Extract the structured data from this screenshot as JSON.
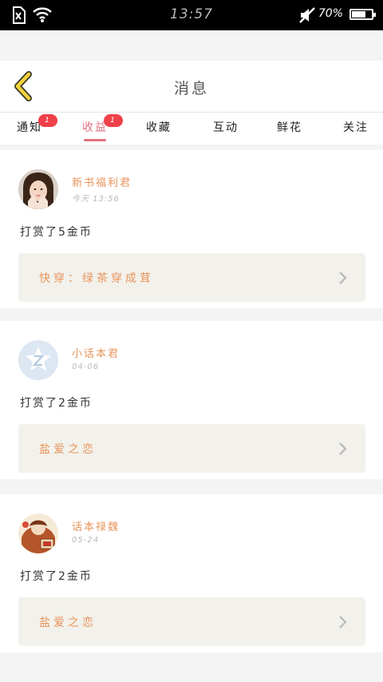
{
  "status_bar": {
    "time": "13:57",
    "battery_percent_label": "70%",
    "battery_level": 0.7,
    "icons": [
      "sim-card-icon",
      "wifi-icon",
      "mute-icon",
      "battery-icon"
    ]
  },
  "header": {
    "title": "消息",
    "back_icon": "chevron-left-icon"
  },
  "tabs": [
    {
      "label": "通知",
      "badge": "1",
      "active": false
    },
    {
      "label": "收益",
      "badge": "1",
      "active": true
    },
    {
      "label": "收藏",
      "active": false
    },
    {
      "label": "互动",
      "active": false
    },
    {
      "label": "鲜花",
      "active": false
    },
    {
      "label": "关注",
      "active": false
    }
  ],
  "messages": [
    {
      "name": "新书福利君",
      "time": "今天 13:56",
      "text": "打赏了5金币",
      "book": "快穿：绿茶穿成茸",
      "avatar": "girl-portrait"
    },
    {
      "name": "小话本君",
      "time": "04-06",
      "text": "打赏了2金币",
      "book": "盐爱之恋",
      "avatar": "default-z-avatar"
    },
    {
      "name": "话本禄魏",
      "time": "05-24",
      "text": "打赏了2金币",
      "book": "盐爱之恋",
      "avatar": "illustrated-avatar"
    }
  ],
  "colors": {
    "accent_pink": "#e07080",
    "name_orange": "#e8955c",
    "badge_red": "#f0404a",
    "link_box_bg": "#f3f1eb",
    "back_yellow": "#f2d33c"
  }
}
